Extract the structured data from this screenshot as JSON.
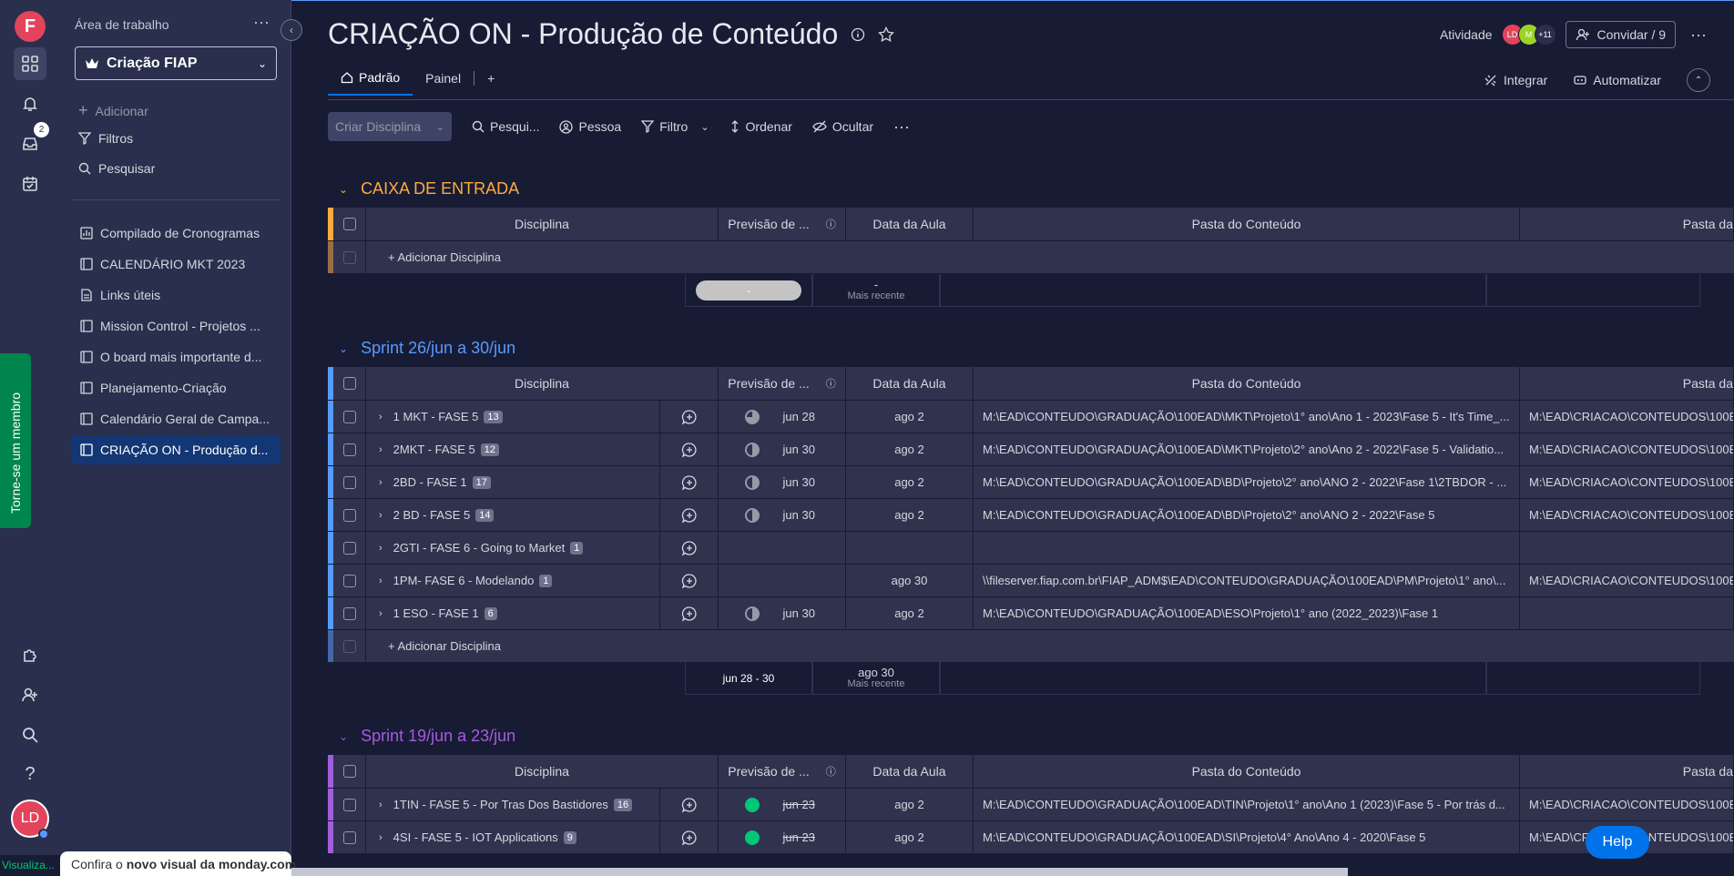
{
  "rail": {
    "logo": "F",
    "inbox_badge": "2",
    "avatar": "LD",
    "member_tab": "Torne-se um membro"
  },
  "sidebar": {
    "workspace_label": "Área de trabalho",
    "workspace_name": "Criação FIAP",
    "actions": {
      "add": "Adicionar",
      "filters": "Filtros",
      "search": "Pesquisar"
    },
    "boards": [
      "Compilado de Cronogramas",
      "CALENDÁRIO MKT 2023",
      "Links úteis",
      "Mission Control - Projetos ...",
      "O board mais importante d...",
      "Planejamento-Criação",
      "Calendário Geral de Campa...",
      "CRIAÇÃO ON - Produção d..."
    ],
    "bottom_strip": "Visualiza...",
    "promo_prefix": "Confira o ",
    "promo_bold": "novo visual da monday.com"
  },
  "header": {
    "title": "CRIAÇÃO ON - Produção de Conteúdo",
    "activity": "Atividade",
    "avatars": [
      "LD",
      "M",
      "+11"
    ],
    "invite": "Convidar / 9",
    "tabs": [
      "Padrão",
      "Painel",
      "+"
    ],
    "integrate": "Integrar",
    "automate": "Automatizar"
  },
  "toolbar": {
    "create": "Criar Disciplina",
    "search": "Pesqui...",
    "person": "Pessoa",
    "filter": "Filtro",
    "sort": "Ordenar",
    "hide": "Ocultar"
  },
  "columns": {
    "name": "Disciplina",
    "forecast": "Previsão de ...",
    "date": "Data da Aula",
    "folder": "Pasta do Conteúdo",
    "folder2": "Pasta da"
  },
  "add_item": "+ Adicionar Disciplina",
  "groups": [
    {
      "title": "CAIXA DE ENTRADA",
      "color": "#fdab3d",
      "items": [],
      "summary": {
        "forecast": "-",
        "date": "-",
        "date_sub": "Mais recente"
      }
    },
    {
      "title": "Sprint 26/jun a 30/jun",
      "color": "#579bfc",
      "items": [
        {
          "name": "1 MKT - FASE 5",
          "count": "13",
          "status": "q",
          "forecast": "jun 28",
          "date": "ago 2",
          "folder": "M:\\EAD\\CONTEUDO\\GRADUAÇÃO\\100EAD\\MKT\\Projeto\\1° ano\\Ano 1 - 2023\\Fase 5 - It's Time_...",
          "folder2": "M:\\EAD\\CRIACAO\\CONTEUDOS\\100E"
        },
        {
          "name": "2MKT - FASE 5",
          "count": "12",
          "status": "half",
          "forecast": "jun 30",
          "date": "ago 2",
          "folder": "M:\\EAD\\CONTEUDO\\GRADUAÇÃO\\100EAD\\MKT\\Projeto\\2° ano\\Ano 2 - 2022\\Fase 5 - Validatio...",
          "folder2": "M:\\EAD\\CRIACAO\\CONTEUDOS\\100E"
        },
        {
          "name": "2BD - FASE 1",
          "count": "17",
          "status": "half",
          "forecast": "jun 30",
          "date": "ago 2",
          "folder": "M:\\EAD\\CONTEUDO\\GRADUAÇÃO\\100EAD\\BD\\Projeto\\2° ano\\ANO 2 - 2022\\Fase 1\\2TBDOR - ...",
          "folder2": "M:\\EAD\\CRIACAO\\CONTEUDOS\\100E"
        },
        {
          "name": "2 BD - FASE 5",
          "count": "14",
          "status": "half",
          "forecast": "jun 30",
          "date": "ago 2",
          "folder": "M:\\EAD\\CONTEUDO\\GRADUAÇÃO\\100EAD\\BD\\Projeto\\2° ano\\ANO 2 - 2022\\Fase 5",
          "folder2": "M:\\EAD\\CRIACAO\\CONTEUDOS\\100E"
        },
        {
          "name": "2GTI - FASE 6 - Going to Market",
          "count": "1",
          "status": "",
          "forecast": "",
          "date": "",
          "folder": "",
          "folder2": ""
        },
        {
          "name": "1PM- FASE 6 - Modelando",
          "count": "1",
          "status": "",
          "forecast": "",
          "date": "ago 30",
          "folder": "\\\\fileserver.fiap.com.br\\FIAP_ADM$\\EAD\\CONTEUDO\\GRADUAÇÃO\\100EAD\\PM\\Projeto\\1° ano\\...",
          "folder2": "M:\\EAD\\CRIACAO\\CONTEUDOS\\100E"
        },
        {
          "name": "1 ESO - FASE 1",
          "count": "6",
          "status": "half",
          "forecast": "jun 30",
          "date": "ago 2",
          "folder": "M:\\EAD\\CONTEUDO\\GRADUAÇÃO\\100EAD\\ESO\\Projeto\\1° ano (2022_2023)\\Fase 1",
          "folder2": ""
        }
      ],
      "summary": {
        "forecast": "jun 28 - 30",
        "date": "ago 30",
        "date_sub": "Mais recente"
      }
    },
    {
      "title": "Sprint 19/jun a 23/jun",
      "color": "#a25ddc",
      "items": [
        {
          "name": "1TIN - FASE 5 - Por Tras Dos Bastidores",
          "count": "16",
          "status": "done",
          "forecast": "jun 23",
          "date": "ago 2",
          "folder": "M:\\EAD\\CONTEUDO\\GRADUAÇÃO\\100EAD\\TIN\\Projeto\\1° ano\\Ano 1 (2023)\\Fase 5 - Por trás d...",
          "folder2": "M:\\EAD\\CRIACAO\\CONTEUDOS\\100E"
        },
        {
          "name": "4SI - FASE 5 - IOT Applications",
          "count": "9",
          "status": "done",
          "forecast": "jun 23",
          "date": "ago 2",
          "folder": "M:\\EAD\\CONTEUDO\\GRADUAÇÃO\\100EAD\\SI\\Projeto\\4° Ano\\Ano 4 - 2020\\Fase 5",
          "folder2": "M:\\EAD\\CRIACAO\\CONTEUDOS\\100E"
        }
      ]
    }
  ],
  "help": "Help"
}
